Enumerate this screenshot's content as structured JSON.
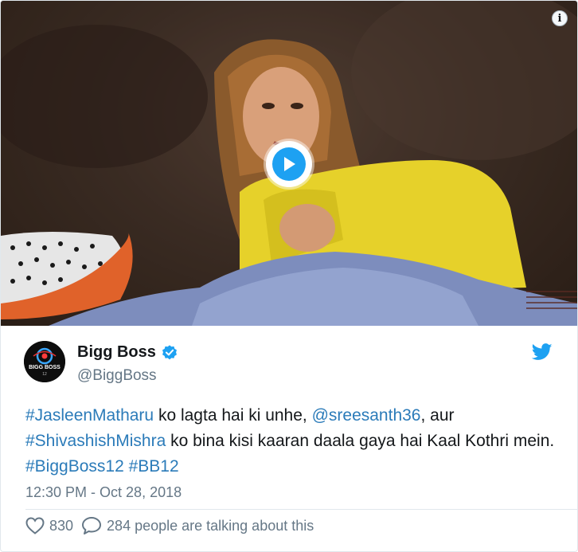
{
  "media": {
    "info_symbol": "i",
    "play_icon": "play-icon",
    "play_color": "#1da1f2"
  },
  "author": {
    "name": "Bigg Boss",
    "handle": "@BiggBoss",
    "avatar_text_top": "BIGG BOSS",
    "avatar_text_bottom": "12",
    "verified_icon": "verified-badge-icon",
    "verified_color": "#1da1f2"
  },
  "brand": {
    "icon": "twitter-bird-icon",
    "color": "#1da1f2"
  },
  "tweet": {
    "hashtag1": "#JasleenMatharu",
    "text1": " ko lagta hai ki unhe, ",
    "mention1": "@sreesanth36",
    "text2": ", aur",
    "hashtag2": "#ShivashishMishra",
    "text3": " ko bina kisi kaaran daala gaya hai Kaal Kothri mein. ",
    "hashtag3": "#BiggBoss12",
    "text4": " ",
    "hashtag4": "#BB12",
    "link_color": "#2b7bb9"
  },
  "timestamp": "12:30 PM - Oct 28, 2018",
  "actions": {
    "likes": "830",
    "talking": "284 people are talking about this"
  }
}
